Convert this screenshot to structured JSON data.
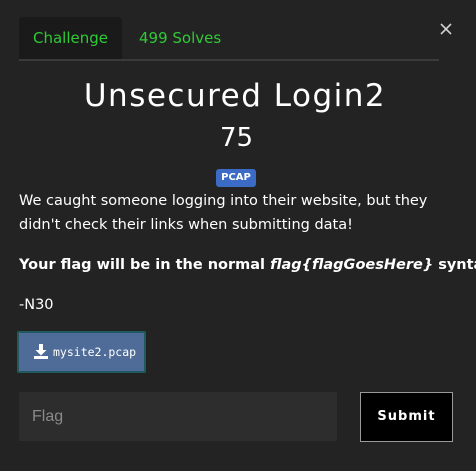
{
  "tabs": [
    {
      "label": "Challenge",
      "active": true
    },
    {
      "label": "499 Solves",
      "active": false
    }
  ],
  "close_icon": "close-icon",
  "challenge": {
    "title": "Unsecured Login2",
    "points": "75",
    "tag": "PCAP",
    "description": "We caught someone logging into their website, but they didn't check their links when submitting data!",
    "flag_format": {
      "prefix": "Your flag will be in the normal ",
      "syntax": "flag{flagGoesHere}",
      "suffix": " syntax."
    },
    "author": "-N30",
    "file": {
      "name": "mysite2.pcap",
      "icon": "download-icon"
    }
  },
  "form": {
    "flag_placeholder": "Flag",
    "flag_value": "",
    "submit_label": "Submit"
  },
  "colors": {
    "background": "#232323",
    "accent": "#2fca36",
    "badge": "#3c6bc6",
    "download_button": "#4f6c99"
  }
}
